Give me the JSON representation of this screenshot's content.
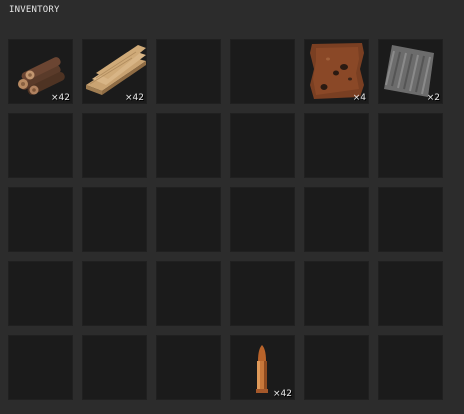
{
  "panel": {
    "title": "INVENTORY"
  },
  "inventory": {
    "slots": [
      {
        "item": "wood-logs-icon",
        "count": "×42"
      },
      {
        "item": "wood-planks-icon",
        "count": "×42"
      },
      {
        "item": "",
        "count": ""
      },
      {
        "item": "",
        "count": ""
      },
      {
        "item": "leather-icon",
        "count": "×4"
      },
      {
        "item": "metal-sheet-icon",
        "count": "×2"
      },
      {
        "item": "",
        "count": ""
      },
      {
        "item": "",
        "count": ""
      },
      {
        "item": "",
        "count": ""
      },
      {
        "item": "",
        "count": ""
      },
      {
        "item": "",
        "count": ""
      },
      {
        "item": "",
        "count": ""
      },
      {
        "item": "",
        "count": ""
      },
      {
        "item": "",
        "count": ""
      },
      {
        "item": "",
        "count": ""
      },
      {
        "item": "",
        "count": ""
      },
      {
        "item": "",
        "count": ""
      },
      {
        "item": "",
        "count": ""
      },
      {
        "item": "",
        "count": ""
      },
      {
        "item": "",
        "count": ""
      },
      {
        "item": "",
        "count": ""
      },
      {
        "item": "",
        "count": ""
      },
      {
        "item": "",
        "count": ""
      },
      {
        "item": "",
        "count": ""
      },
      {
        "item": "",
        "count": ""
      },
      {
        "item": "",
        "count": ""
      },
      {
        "item": "",
        "count": ""
      },
      {
        "item": "bullet-icon",
        "count": "×42"
      },
      {
        "item": "",
        "count": ""
      },
      {
        "item": "",
        "count": ""
      }
    ]
  },
  "colors": {
    "background": "#2c2c2c",
    "slot": "#1b1b1b",
    "text": "#e6e6e6"
  }
}
